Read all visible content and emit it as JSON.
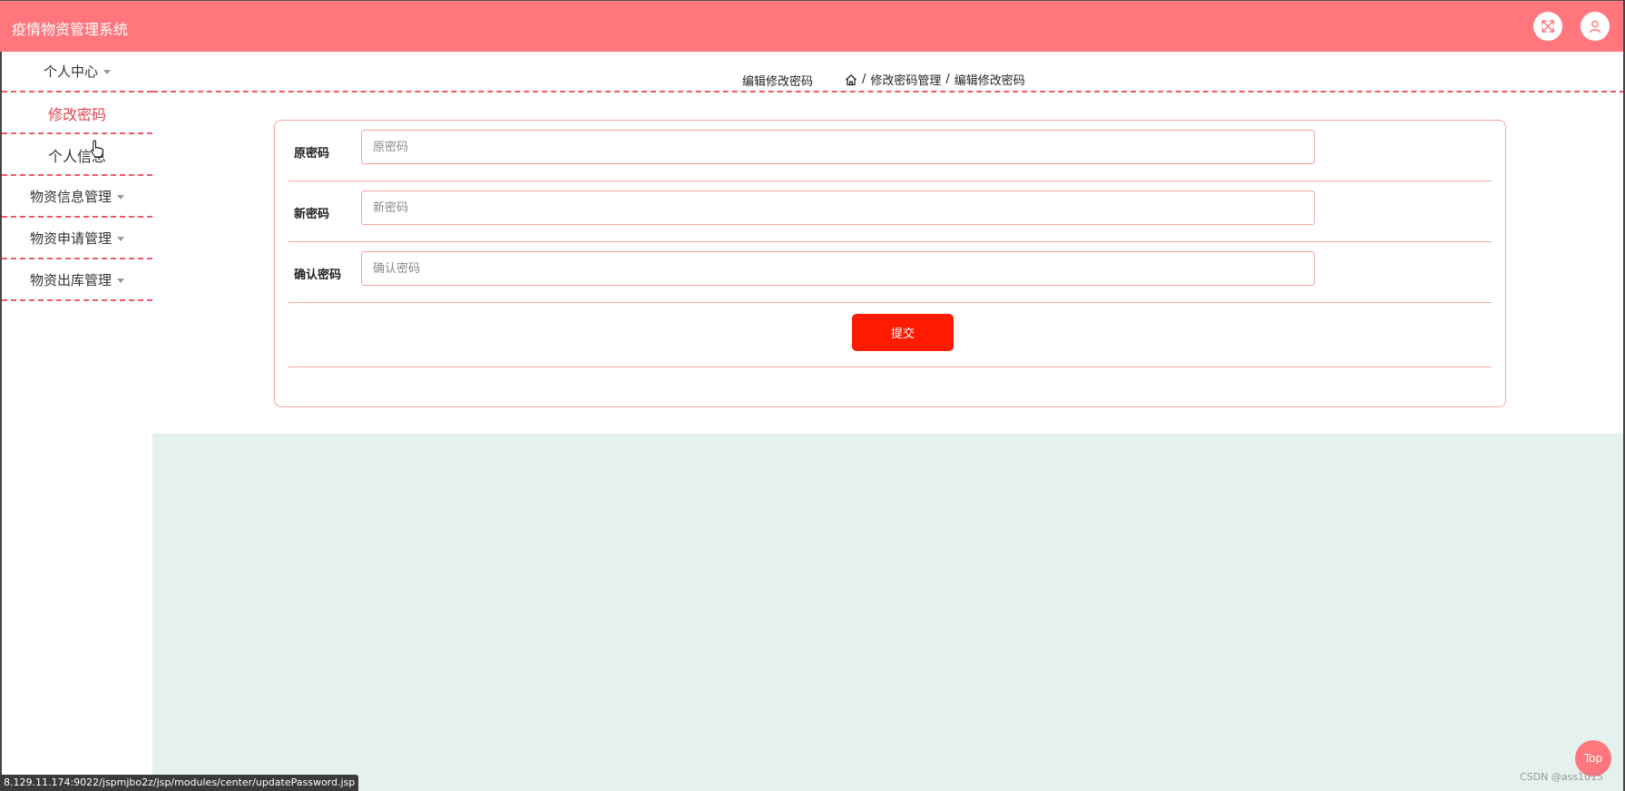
{
  "header": {
    "app_title": "疫情物资管理系统",
    "fullscreen_icon": "expand-icon",
    "user_icon": "user-icon",
    "accent_color": "#ff767c"
  },
  "sidebar": {
    "items": [
      {
        "label": "个人中心",
        "type": "group"
      },
      {
        "label": "修改密码",
        "type": "sub",
        "active": true
      },
      {
        "label": "个人信息",
        "type": "sub"
      },
      {
        "label": "物资信息管理",
        "type": "group"
      },
      {
        "label": "物资申请管理",
        "type": "group"
      },
      {
        "label": "物资出库管理",
        "type": "group"
      }
    ]
  },
  "breadcrumb": {
    "page_label": "编辑修改密码",
    "home_icon": "home-icon",
    "items": [
      "修改密码管理",
      "编辑修改密码"
    ],
    "separator": "/"
  },
  "form": {
    "fields": [
      {
        "label": "原密码",
        "placeholder": "原密码",
        "value": ""
      },
      {
        "label": "新密码",
        "placeholder": "新密码",
        "value": ""
      },
      {
        "label": "确认密码",
        "placeholder": "确认密码",
        "value": ""
      }
    ],
    "submit_label": "提交",
    "submit_color": "#ff1a00"
  },
  "status_url": "8.129.11.174:9022/jspmjbo2z/jsp/modules/center/updatePassword.jsp",
  "back_to_top_label": "Top",
  "watermark": "CSDN @ass1015"
}
